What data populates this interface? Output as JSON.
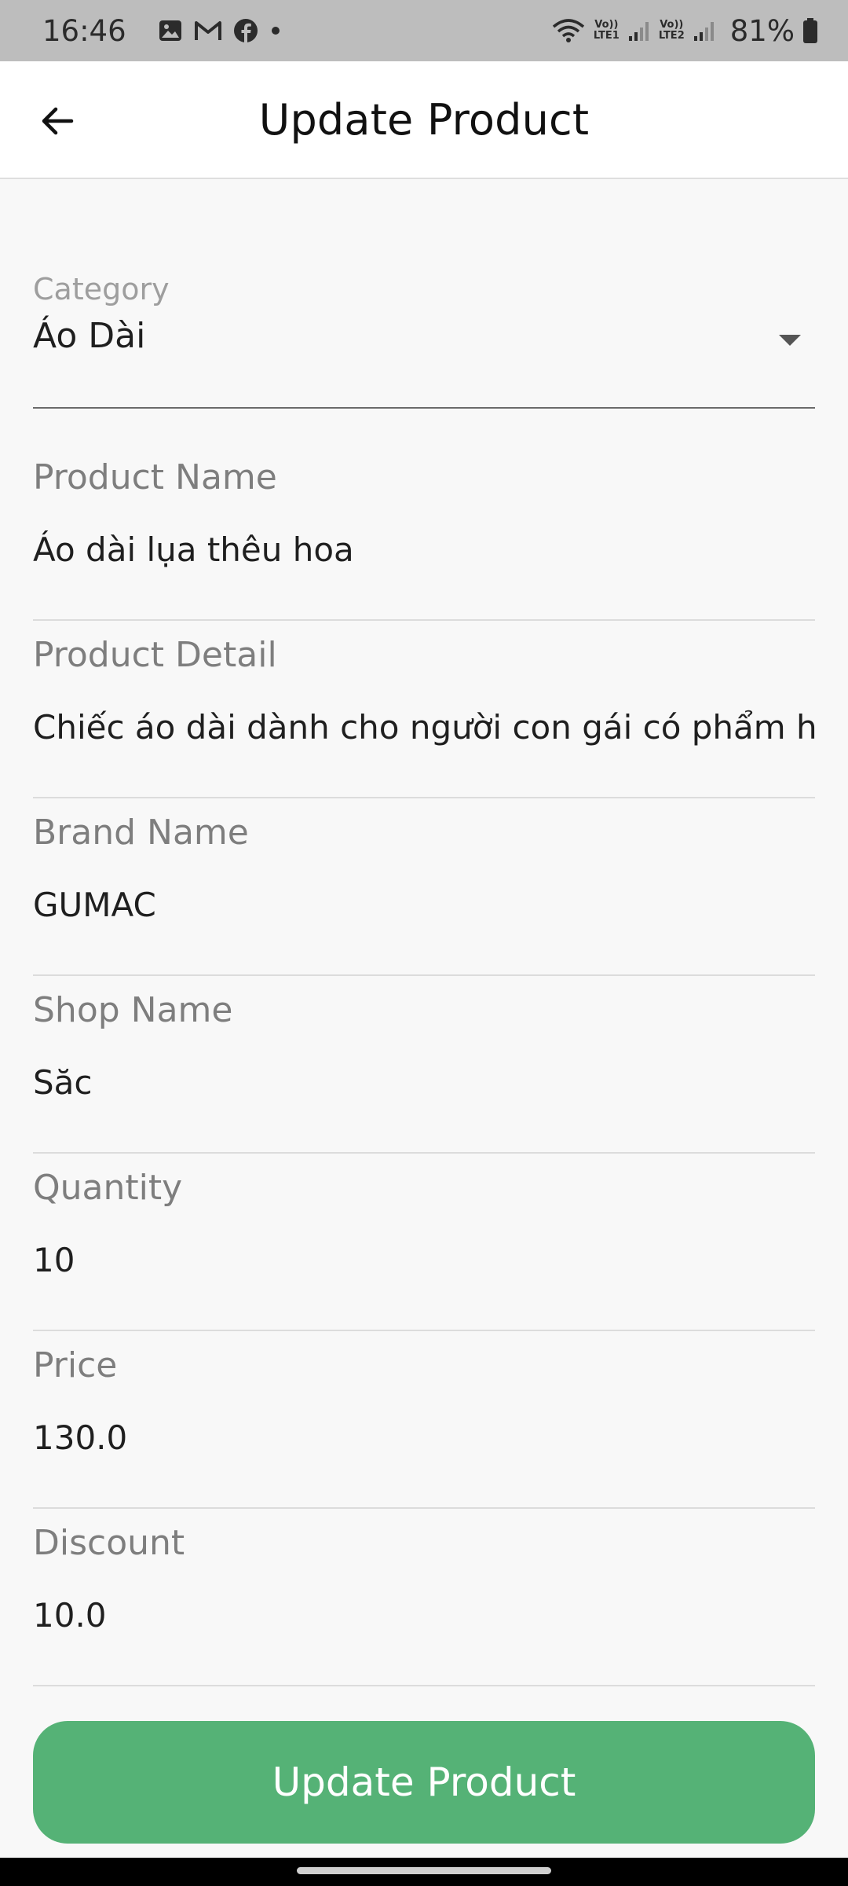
{
  "status_bar": {
    "time": "16:46",
    "notification_icons": [
      "gallery-icon",
      "gmail-icon",
      "facebook-icon",
      "dot-icon"
    ],
    "sim1_label_top": "Vo))",
    "sim1_label_bottom": "LTE1",
    "sim2_label_top": "Vo))",
    "sim2_label_bottom": "LTE2",
    "battery": "81%"
  },
  "app_bar": {
    "title": "Update Product",
    "back_icon": "arrow-left-icon"
  },
  "form": {
    "category": {
      "label": "Category",
      "value": "Áo Dài"
    },
    "fields": [
      {
        "name": "product-name",
        "label": "Product Name",
        "value": "Áo dài lụa thêu hoa"
      },
      {
        "name": "product-detail",
        "label": "Product Detail",
        "value": "Chiếc áo dài dành cho người con gái có phẩm h"
      },
      {
        "name": "brand-name",
        "label": "Brand Name",
        "value": "GUMAC"
      },
      {
        "name": "shop-name",
        "label": "Shop Name",
        "value": "Săc"
      },
      {
        "name": "quantity",
        "label": "Quantity",
        "value": "10"
      },
      {
        "name": "price",
        "label": "Price",
        "value": "130.0"
      },
      {
        "name": "discount",
        "label": "Discount",
        "value": "10.0"
      }
    ]
  },
  "update_button": {
    "label": "Update Product"
  },
  "colors": {
    "accent": "#55b276",
    "status_bar": "#bdbdbd",
    "background": "#f8f8f8"
  }
}
